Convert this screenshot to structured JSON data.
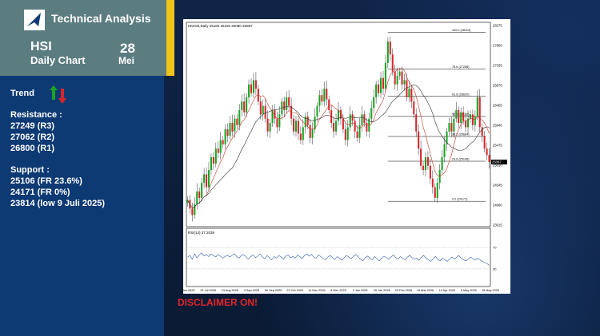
{
  "header": {
    "app_title": "Technical Analysis",
    "ticker": "HSI",
    "subtitle": "Daily Chart",
    "day": "28",
    "month": "Mei"
  },
  "trend": {
    "label": "Trend",
    "icon": "up-down-arrows-icon"
  },
  "resistance": {
    "title": "Resistance :",
    "levels": [
      "27249 (R3)",
      "27062 (R2)",
      "26800 (R1)"
    ]
  },
  "support": {
    "title": "Support :",
    "levels": [
      "25106 (FR 23.6%)",
      "24171 (FR 0%)",
      "23814 (low 9 Juli 2025)"
    ]
  },
  "disclaimer": "DISCLAIMER ON!",
  "colors": {
    "up": "#1aa324",
    "down": "#d7262b",
    "accent": "#f0c419",
    "sidebar": "#0e3a74",
    "header": "#5c7d80"
  },
  "chart_data": {
    "type": "candlestick",
    "title": "HKK50,Daily 25160 25160 25080 25087",
    "price_axis": [
      "28275",
      "27800",
      "27335",
      "26870",
      "26405",
      "25940",
      "25475",
      "25010",
      "24545",
      "24080",
      "23615"
    ],
    "ylim": [
      23615,
      28275
    ],
    "current_price": "25087",
    "fibonacci": [
      {
        "label": "100.0 (28113)",
        "value": 28113
      },
      {
        "label": "78.6 (27258)",
        "value": 27258
      },
      {
        "label": "61.8 (26620)",
        "value": 26620
      },
      {
        "label": "50.0 (26152)",
        "value": 26152
      },
      {
        "label": "38.2 (25684)",
        "value": 25684
      },
      {
        "label": "23.6 (25106)",
        "value": 25106
      },
      {
        "label": "0.0 (24171)",
        "value": 24171
      }
    ],
    "rsi": {
      "label": "RSI(14) 37.2038",
      "levels": [
        "70",
        "30"
      ],
      "ylim": [
        0,
        100
      ],
      "values": [
        52,
        55,
        48,
        58,
        50,
        56,
        60,
        54,
        57,
        53,
        58,
        55,
        52,
        57,
        54,
        50,
        53,
        56,
        52,
        55,
        58,
        53,
        50,
        55,
        57,
        52,
        48,
        53,
        56,
        51,
        54,
        58,
        52,
        49,
        55,
        51,
        47,
        53,
        50,
        55,
        52,
        48,
        54,
        56,
        51,
        53,
        50,
        56,
        53,
        49,
        55,
        58,
        54,
        57,
        52,
        50,
        56,
        53,
        49,
        47,
        52,
        55,
        51,
        48,
        53,
        50,
        46,
        51,
        55,
        52,
        49,
        54,
        57,
        52,
        48,
        45,
        51,
        54,
        50,
        47,
        53,
        49,
        45,
        50,
        54,
        51,
        48,
        52,
        56,
        51,
        49,
        53,
        50,
        47,
        52,
        55,
        51,
        48,
        50,
        46,
        52,
        55,
        50,
        47,
        44,
        49,
        53,
        48,
        45,
        50,
        47,
        44,
        48,
        52,
        49,
        51,
        55,
        50,
        47,
        45,
        48,
        52,
        49,
        46,
        50,
        47,
        44,
        42,
        40,
        37
      ]
    },
    "x_ticks": [
      "17 Jun 2025",
      "22 Jul 2025",
      "13 Aug 2025",
      "4 Sep 2025",
      "26 Sep 2025",
      "22 Oct 2025",
      "14 Nov 2025",
      "8 Dec 2025",
      "2 Jan 2026",
      "26 Jan 2026",
      "20 Feb 2026",
      "16 Mar 2026",
      "10 Apr 2026",
      "5 May 2026",
      "28 May 2026"
    ],
    "closes": [
      24200,
      24000,
      23850,
      24100,
      24400,
      24250,
      24600,
      24800,
      24500,
      24900,
      25200,
      25050,
      25400,
      25300,
      25600,
      25500,
      25850,
      25700,
      26000,
      25800,
      26100,
      25950,
      26300,
      26500,
      26250,
      26600,
      26900,
      26700,
      27000,
      26800,
      26500,
      26200,
      26400,
      26100,
      25800,
      26000,
      26300,
      26100,
      25900,
      26200,
      26500,
      26300,
      26600,
      26400,
      26100,
      25800,
      26050,
      25750,
      25600,
      25900,
      26150,
      25950,
      25650,
      25850,
      26150,
      26400,
      26650,
      26500,
      26800,
      26550,
      26300,
      26000,
      25800,
      26050,
      26300,
      26100,
      25850,
      25600,
      25900,
      26200,
      26050,
      25800,
      25650,
      25950,
      26200,
      26000,
      25800,
      26100,
      26350,
      26600,
      26900,
      26700,
      27050,
      26800,
      27400,
      27900,
      27600,
      27200,
      26900,
      27100,
      27200,
      26900,
      27000,
      26600,
      26800,
      26500,
      26200,
      25800,
      25400,
      25000,
      24900,
      25200,
      25000,
      24700,
      24500,
      24250,
      24600,
      24900,
      25200,
      25500,
      25800,
      26000,
      25800,
      26100,
      26300,
      26000,
      26250,
      26050,
      25900,
      26100,
      26200,
      25950,
      26150,
      26600,
      25900,
      25700,
      25400,
      25250,
      25087
    ]
  }
}
